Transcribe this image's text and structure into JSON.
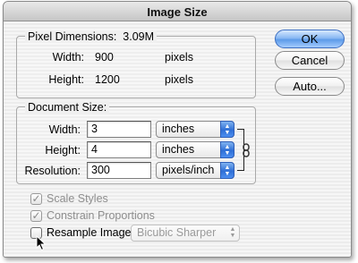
{
  "window": {
    "title": "Image Size"
  },
  "pixel_dimensions": {
    "header": "Pixel Dimensions:",
    "value": "3.09M",
    "width_label": "Width:",
    "width_value": "900",
    "width_unit": "pixels",
    "height_label": "Height:",
    "height_value": "1200",
    "height_unit": "pixels"
  },
  "document_size": {
    "header": "Document Size:",
    "width_label": "Width:",
    "width_value": "3",
    "width_unit": "inches",
    "height_label": "Height:",
    "height_value": "4",
    "height_unit": "inches",
    "resolution_label": "Resolution:",
    "resolution_value": "300",
    "resolution_unit": "pixels/inch"
  },
  "buttons": {
    "ok": "OK",
    "cancel": "Cancel",
    "auto": "Auto..."
  },
  "options": {
    "scale_styles": {
      "label": "Scale Styles",
      "checked": true,
      "enabled": false
    },
    "constrain": {
      "label": "Constrain Proportions",
      "checked": true,
      "enabled": false
    },
    "resample": {
      "label": "Resample Image:",
      "checked": false,
      "enabled": true
    },
    "resample_method": "Bicubic Sharper"
  },
  "colors": {
    "accent": "#5d9be8",
    "disabled_text": "#8e8e8e"
  }
}
